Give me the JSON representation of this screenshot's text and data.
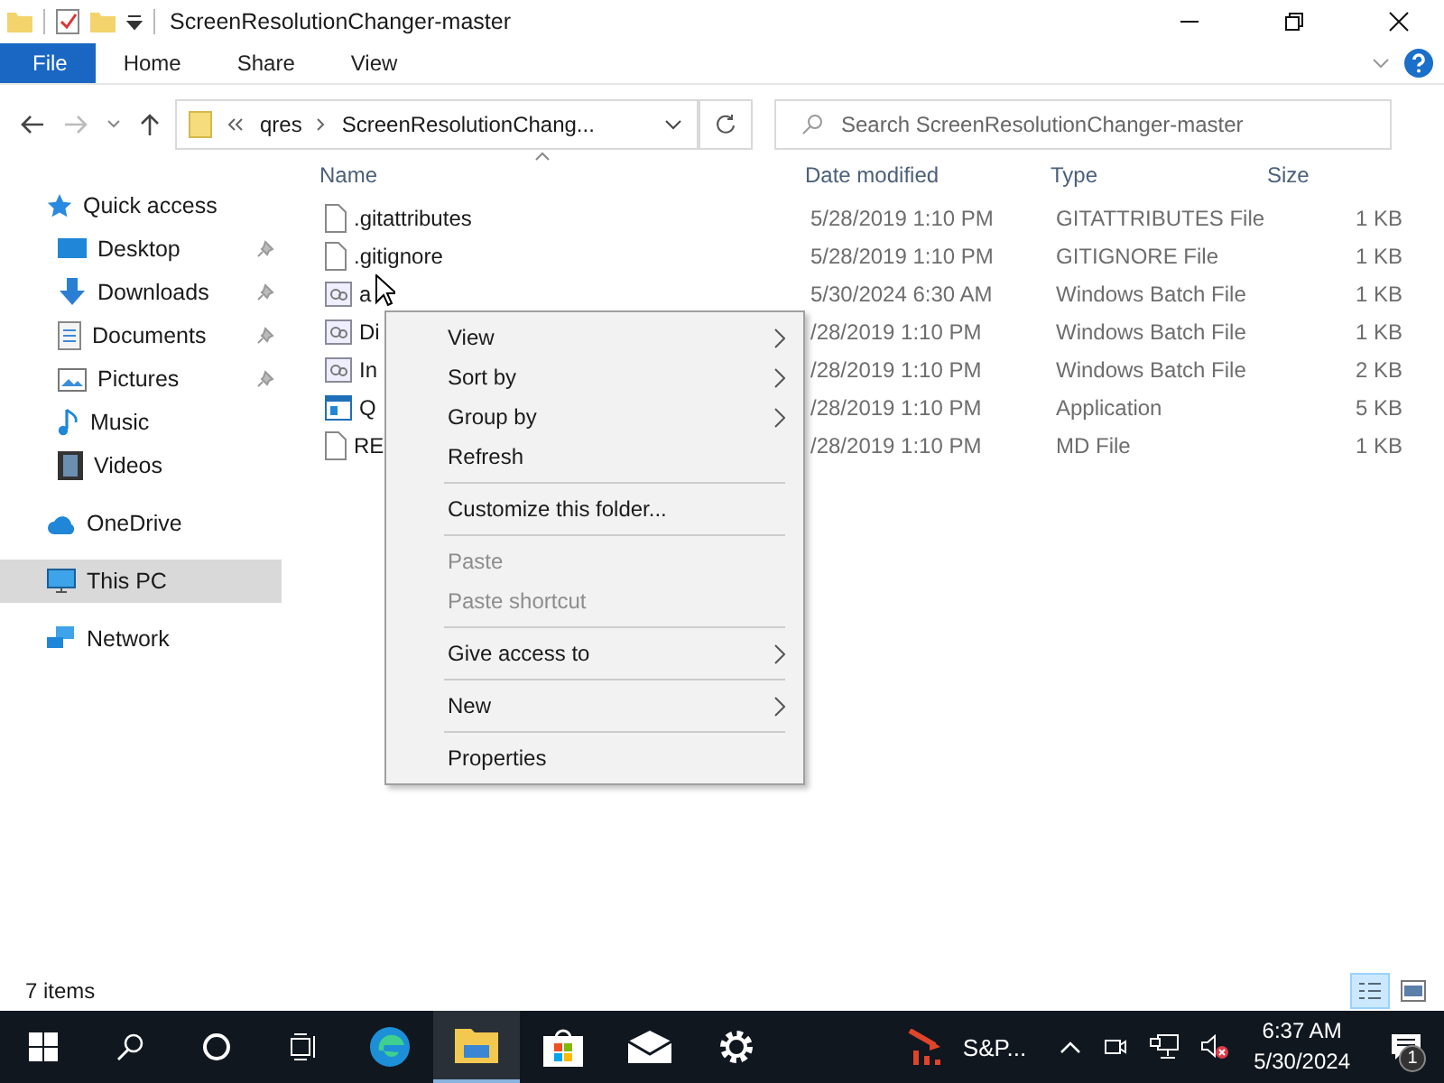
{
  "window": {
    "title": "ScreenResolutionChanger-master"
  },
  "ribbon": {
    "tabs": [
      {
        "label": "File",
        "selected": true
      },
      {
        "label": "Home",
        "selected": false
      },
      {
        "label": "Share",
        "selected": false
      },
      {
        "label": "View",
        "selected": false
      }
    ]
  },
  "address": {
    "crumbs": [
      "qres",
      "ScreenResolutionChang..."
    ]
  },
  "search": {
    "placeholder": "Search ScreenResolutionChanger-master"
  },
  "sidebar": {
    "items": [
      {
        "label": "Quick access",
        "selected": false,
        "children": [
          {
            "label": "Desktop",
            "pinned": true
          },
          {
            "label": "Downloads",
            "pinned": true
          },
          {
            "label": "Documents",
            "pinned": true
          },
          {
            "label": "Pictures",
            "pinned": true
          },
          {
            "label": "Music",
            "pinned": false
          },
          {
            "label": "Videos",
            "pinned": false
          }
        ]
      },
      {
        "label": "OneDrive",
        "selected": false
      },
      {
        "label": "This PC",
        "selected": true
      },
      {
        "label": "Network",
        "selected": false
      }
    ]
  },
  "table": {
    "columns": [
      "Name",
      "Date modified",
      "Type",
      "Size"
    ],
    "rows": [
      {
        "kind": "file",
        "name": ".gitattributes",
        "date": "5/28/2019 1:10 PM",
        "type": "GITATTRIBUTES File",
        "size": "1 KB"
      },
      {
        "kind": "file",
        "name": ".gitignore",
        "date": "5/28/2019 1:10 PM",
        "type": "GITIGNORE File",
        "size": "1 KB"
      },
      {
        "kind": "batch",
        "name": "a",
        "date": "5/30/2024 6:30 AM",
        "type": "Windows Batch File",
        "size": "1 KB"
      },
      {
        "kind": "batch",
        "name": "Di",
        "date": "/28/2019 1:10 PM",
        "type": "Windows Batch File",
        "size": "1 KB"
      },
      {
        "kind": "batch",
        "name": "In",
        "date": "/28/2019 1:10 PM",
        "type": "Windows Batch File",
        "size": "2 KB"
      },
      {
        "kind": "app",
        "name": "Q",
        "date": "/28/2019 1:10 PM",
        "type": "Application",
        "size": "5 KB"
      },
      {
        "kind": "file",
        "name": "RE",
        "date": "/28/2019 1:10 PM",
        "type": "MD File",
        "size": "1 KB"
      }
    ]
  },
  "context_menu": {
    "items": [
      {
        "kind": "item",
        "label": "View",
        "submenu": true,
        "disabled": false
      },
      {
        "kind": "item",
        "label": "Sort by",
        "submenu": true,
        "disabled": false
      },
      {
        "kind": "item",
        "label": "Group by",
        "submenu": true,
        "disabled": false
      },
      {
        "kind": "item",
        "label": "Refresh",
        "submenu": false,
        "disabled": false
      },
      {
        "kind": "separator"
      },
      {
        "kind": "item",
        "label": "Customize this folder...",
        "submenu": false,
        "disabled": false
      },
      {
        "kind": "separator"
      },
      {
        "kind": "item",
        "label": "Paste",
        "submenu": false,
        "disabled": true
      },
      {
        "kind": "item",
        "label": "Paste shortcut",
        "submenu": false,
        "disabled": true
      },
      {
        "kind": "separator"
      },
      {
        "kind": "item",
        "label": "Give access to",
        "submenu": true,
        "disabled": false
      },
      {
        "kind": "separator"
      },
      {
        "kind": "item",
        "label": "New",
        "submenu": true,
        "disabled": false
      },
      {
        "kind": "separator"
      },
      {
        "kind": "item",
        "label": "Properties",
        "submenu": false,
        "disabled": false
      }
    ]
  },
  "status_bar": {
    "text": "7 items",
    "views": [
      {
        "selected": true
      },
      {
        "selected": false
      }
    ]
  },
  "taskbar": {
    "apps": [
      {
        "active": false
      },
      {
        "active": true
      },
      {
        "active": false
      },
      {
        "active": false
      },
      {
        "active": false
      }
    ],
    "running_app": "S&P...",
    "time": "6:37 AM",
    "date": "5/30/2024",
    "notifications": "1"
  }
}
